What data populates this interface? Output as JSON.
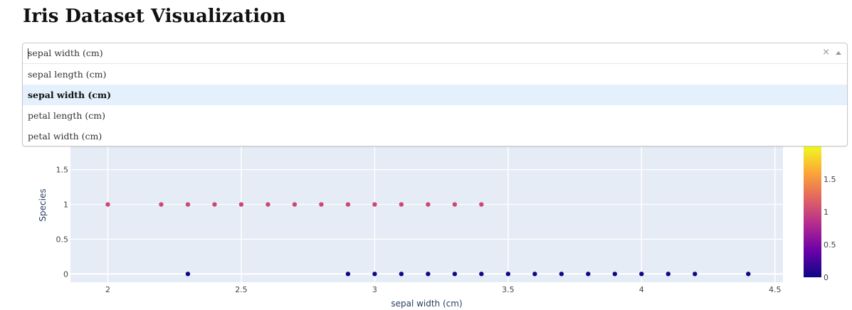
{
  "page": {
    "title": "Iris Dataset Visualization"
  },
  "dropdown": {
    "value": "sepal width (cm)",
    "clear_glyph": "×",
    "options": [
      {
        "label": "sepal length (cm)",
        "selected": false
      },
      {
        "label": "sepal width (cm)",
        "selected": true
      },
      {
        "label": "petal length (cm)",
        "selected": false
      },
      {
        "label": "petal width (cm)",
        "selected": false
      }
    ]
  },
  "chart_data": {
    "type": "scatter",
    "xlabel": "sepal width (cm)",
    "ylabel": "Species",
    "xlim": [
      1.86,
      4.53
    ],
    "ylim": [
      -0.12,
      2.1
    ],
    "xticks": [
      "2",
      "2.5",
      "3",
      "3.5",
      "4",
      "4.5"
    ],
    "yticks": [
      "0",
      "0.5",
      "1",
      "1.5"
    ],
    "grid": true,
    "plot_bgcolor": "#e5ecf6",
    "colorscale": [
      "#0d0887",
      "#6a00a8",
      "#b12a90",
      "#e16462",
      "#fca636",
      "#f0f921"
    ],
    "colorbar": {
      "ticks": [
        "0",
        "0.5",
        "1",
        "1.5"
      ],
      "range": [
        0,
        2
      ]
    },
    "series": [
      {
        "color_value": 0,
        "color": "#0d0887",
        "points": [
          [
            2.3,
            0
          ],
          [
            2.9,
            0
          ],
          [
            3.0,
            0
          ],
          [
            3.1,
            0
          ],
          [
            3.2,
            0
          ],
          [
            3.3,
            0
          ],
          [
            3.4,
            0
          ],
          [
            3.5,
            0
          ],
          [
            3.6,
            0
          ],
          [
            3.7,
            0
          ],
          [
            3.8,
            0
          ],
          [
            3.9,
            0
          ],
          [
            4.0,
            0
          ],
          [
            4.1,
            0
          ],
          [
            4.2,
            0
          ],
          [
            4.4,
            0
          ]
        ]
      },
      {
        "color_value": 1,
        "color": "#cc4778",
        "points": [
          [
            2.0,
            1
          ],
          [
            2.2,
            1
          ],
          [
            2.3,
            1
          ],
          [
            2.4,
            1
          ],
          [
            2.5,
            1
          ],
          [
            2.6,
            1
          ],
          [
            2.7,
            1
          ],
          [
            2.8,
            1
          ],
          [
            2.9,
            1
          ],
          [
            3.0,
            1
          ],
          [
            3.1,
            1
          ],
          [
            3.2,
            1
          ],
          [
            3.3,
            1
          ],
          [
            3.4,
            1
          ]
        ]
      }
    ]
  }
}
